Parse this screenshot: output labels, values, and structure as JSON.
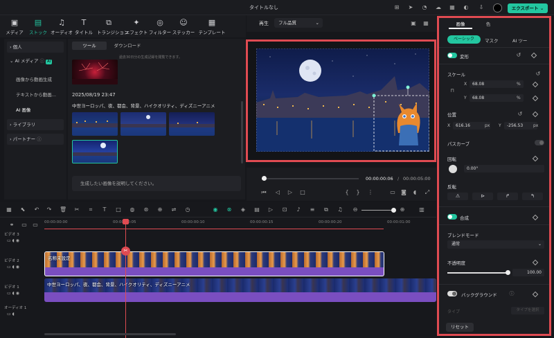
{
  "window": {
    "title": "タイトルなし",
    "export_label": "エクスポート",
    "export_caret": "⌄"
  },
  "toolbar": {
    "items": [
      {
        "icon": "media-icon",
        "glyph": "▣",
        "label": "メディア"
      },
      {
        "icon": "stock-icon",
        "glyph": "▤",
        "label": "ストック",
        "active": true
      },
      {
        "icon": "audio-icon",
        "glyph": "♫",
        "label": "オーディオ"
      },
      {
        "icon": "title-icon",
        "glyph": "T",
        "label": "タイトル"
      },
      {
        "icon": "transition-icon",
        "glyph": "⧉",
        "label": "トランジション"
      },
      {
        "icon": "effect-icon",
        "glyph": "✦",
        "label": "エフェクト"
      },
      {
        "icon": "filter-icon",
        "glyph": "◎",
        "label": "フィルター"
      },
      {
        "icon": "sticker-icon",
        "glyph": "☺",
        "label": "ステッカー"
      },
      {
        "icon": "template-icon",
        "glyph": "▦",
        "label": "テンプレート"
      }
    ]
  },
  "sidebar": {
    "personal": "個人",
    "ai_media": "AI メディア",
    "ai_badge": "AI",
    "items": [
      "画像から動画生成",
      "テキストから動画...",
      "AI 画像"
    ],
    "library": "ライブラリ",
    "partner": "パートナー"
  },
  "panel": {
    "tabs": [
      "ツール",
      "ダウンロード"
    ],
    "notice": "過去30日分の生成記録を閲覧できます。",
    "date": "2025/08/19 23:47",
    "prompt_text": "中世ヨーロッパ、夜、都会、背景、ハイクオリティ、ディズニーアニメ",
    "input_placeholder": "生成したい画像を説明してください。"
  },
  "preview": {
    "play_label": "再生",
    "quality": "フル品質",
    "quality_caret": "⌄",
    "current_time": "00:00:00:06",
    "total_time": "00:00:05:00",
    "time_sep": "/",
    "progress": 0.02
  },
  "right_panel": {
    "tabs": [
      "画像",
      "色"
    ],
    "subtabs": [
      "ベーシック",
      "マスク",
      "AI ツー"
    ],
    "transform": "変形",
    "scale": "スケール",
    "scale_x_label": "X",
    "scale_x": "68.08",
    "scale_x_unit": "%",
    "scale_y_label": "Y",
    "scale_y": "68.08",
    "scale_y_unit": "%",
    "position": "位置",
    "pos_x_label": "X",
    "pos_x": "616.16",
    "pos_x_unit": "px",
    "pos_y_label": "Y",
    "pos_y": "-256.53",
    "pos_y_unit": "px",
    "path_curve": "パスカーブ",
    "rotate": "回転",
    "rotate_value": "0.00°",
    "flip": "反転",
    "composite": "合成",
    "blend_mode": "ブレンドモード",
    "blend_value": "通常",
    "opacity": "不透明度",
    "opacity_value": "100.00",
    "opacity_fraction": 1.0,
    "background": "バックグラウンド",
    "type_label": "タイプ",
    "type_select": "タイプを選択",
    "reset": "リセット"
  },
  "timeline": {
    "ruler": [
      "00:00:00:00",
      "00:00:00:05",
      "00:00:00:10",
      "00:00:00:15",
      "00:00:00:20",
      "00:00:01:00"
    ],
    "tracks": [
      "ビデオ 3",
      "ビデオ 2",
      "ビデオ 1",
      "オーディオ 1"
    ],
    "clip2_label": "名称未設定",
    "clip1_label": "中世ヨーロッパ、夜、都会、背景、ハイクオリティ、ディズニーアニメ"
  }
}
